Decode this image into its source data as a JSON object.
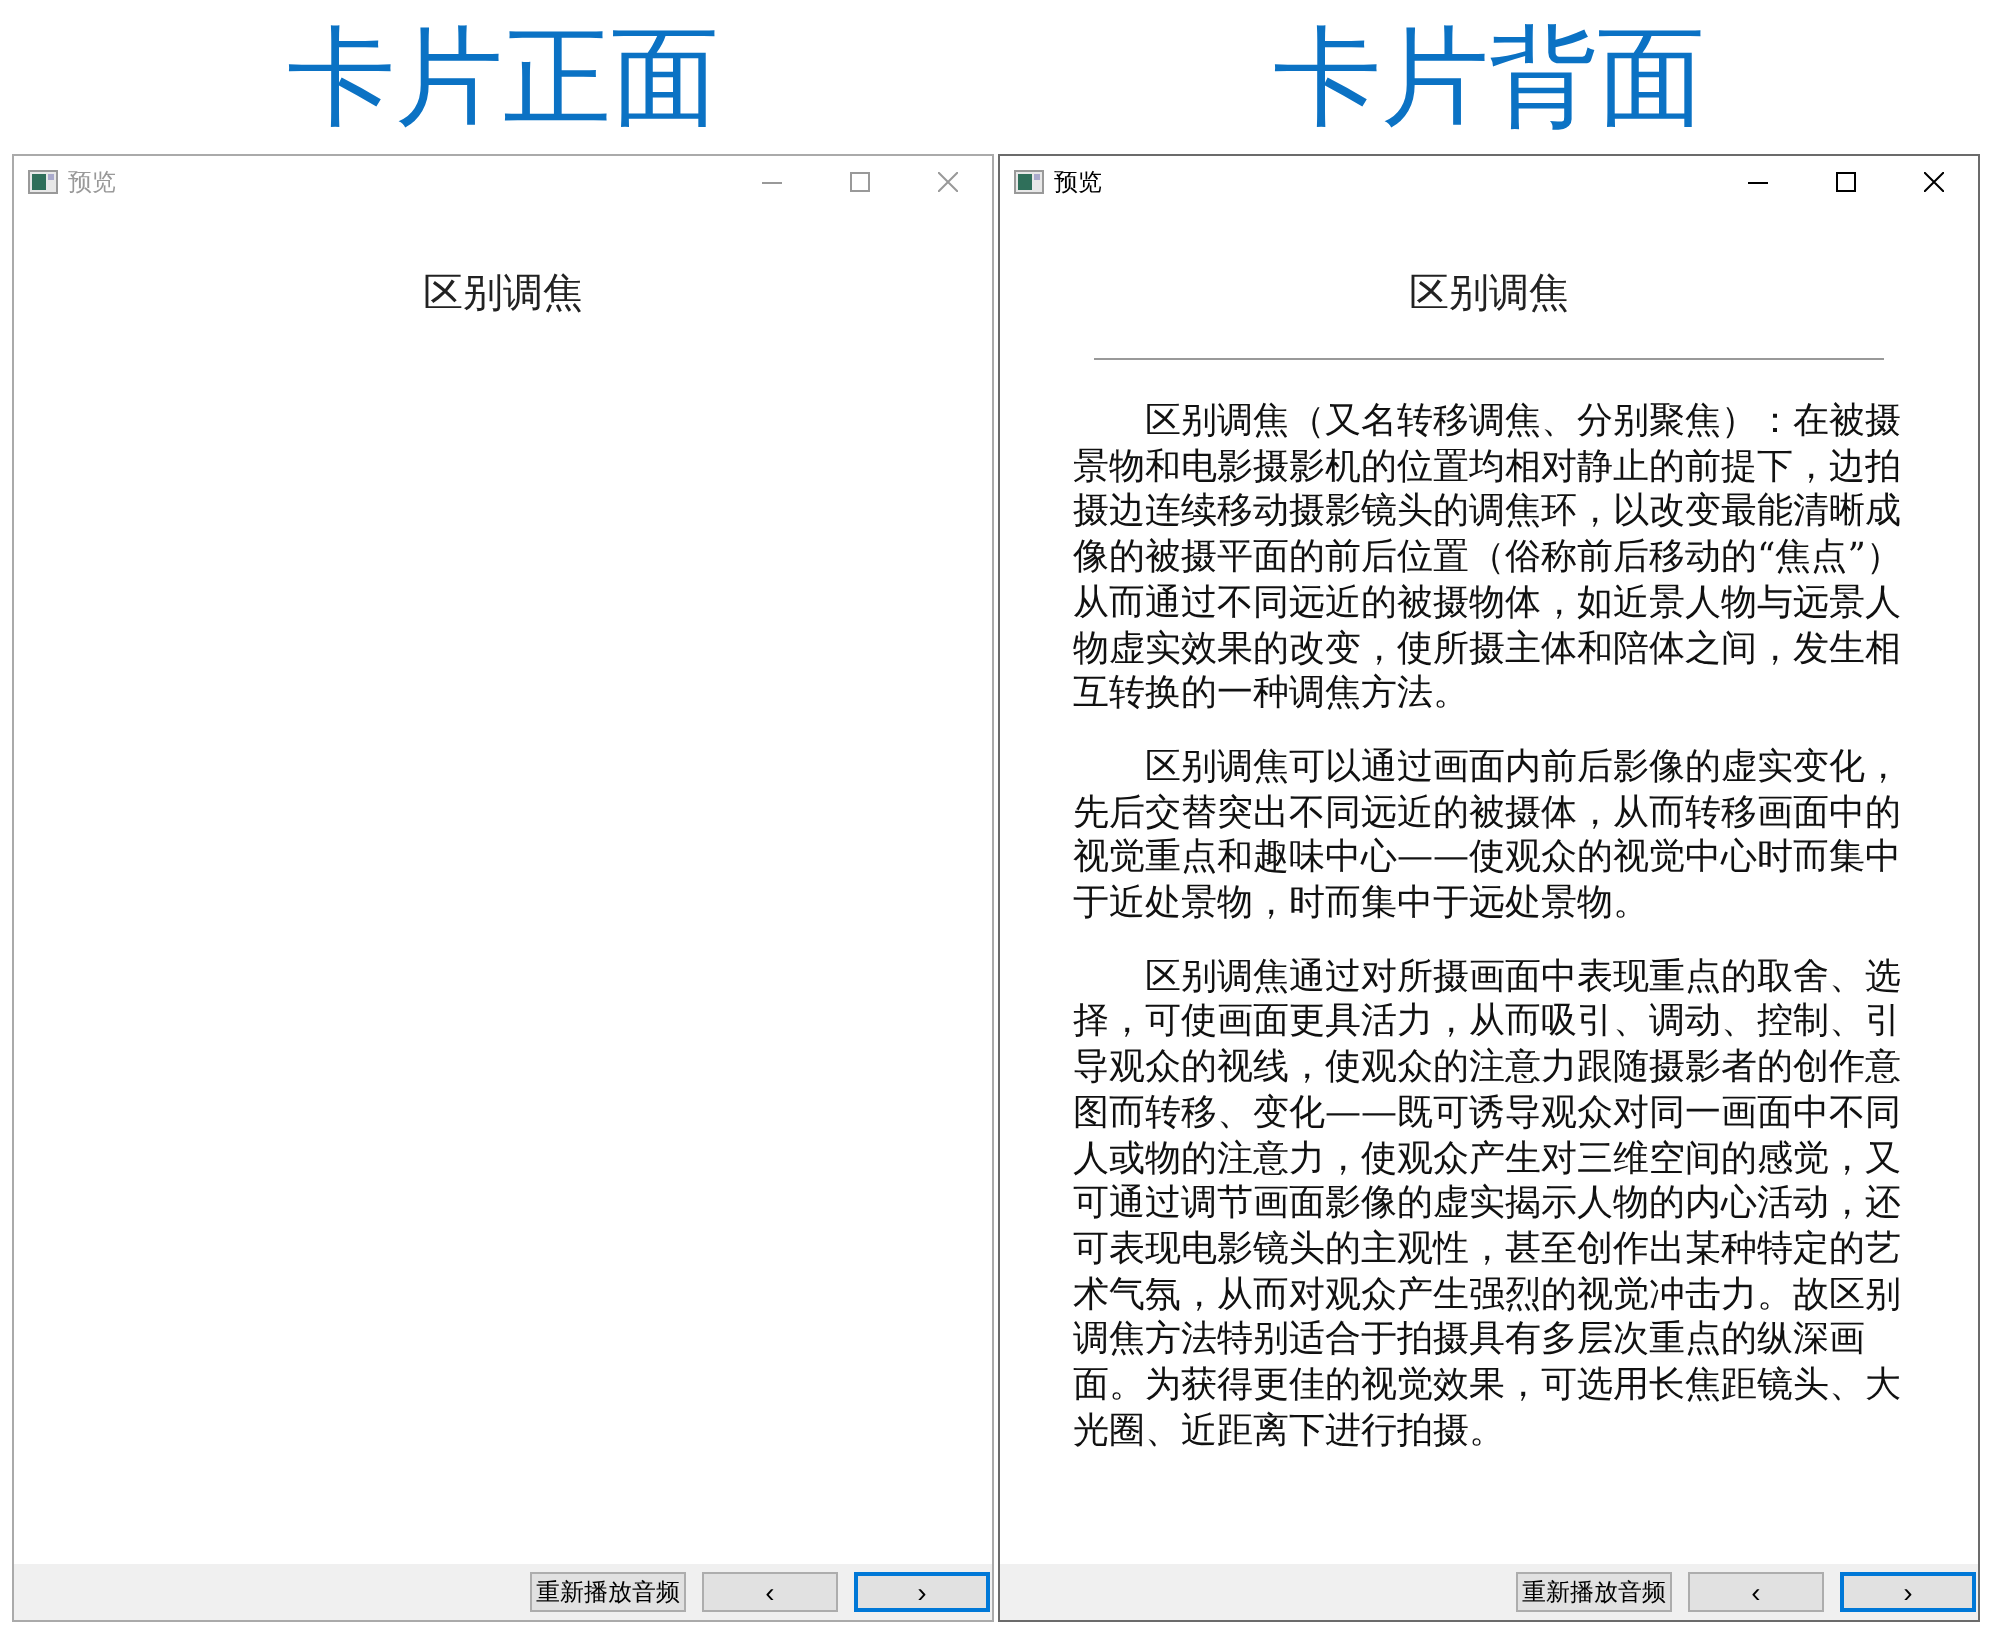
{
  "panels": [
    {
      "caption": "卡片正面",
      "window": {
        "title": "预览",
        "active": false
      },
      "card": {
        "title": "区别调焦"
      },
      "buttons": [
        {
          "label": "重新播放音频",
          "focused": false
        },
        {
          "label": "‹",
          "focused": false
        },
        {
          "label": "›",
          "focused": true
        }
      ]
    },
    {
      "caption": "卡片背面",
      "window": {
        "title": "预览",
        "active": true
      },
      "card": {
        "title": "区别调焦",
        "paragraphs": [
          "区别调焦（又名转移调焦、分别聚焦）：在被摄景物和电影摄影机的位置均相对静止的前提下，边拍摄边连续移动摄影镜头的调焦环，以改变最能清晰成像的被摄平面的前后位置（俗称前后移动的“焦点”）从而通过不同远近的被摄物体，如近景人物与远景人物虚实效果的改变，使所摄主体和陪体之间，发生相互转换的一种调焦方法。",
          "区别调焦可以通过画面内前后影像的虚实变化，先后交替突出不同远近的被摄体，从而转移画面中的视觉重点和趣味中心——使观众的视觉中心时而集中于近处景物，时而集中于远处景物。",
          "区别调焦通过对所摄画面中表现重点的取舍、选择，可使画面更具活力，从而吸引、调动、控制、引导观众的视线，使观众的注意力跟随摄影者的创作意图而转移、变化——既可诱导观众对同一画面中不同人或物的注意力，使观众产生对三维空间的感觉，又可通过调节画面影像的虚实揭示人物的内心活动，还可表现电影镜头的主观性，甚至创作出某种特定的艺术气氛，从而对观众产生强烈的视觉冲击力。故区别调焦方法特别适合于拍摄具有多层次重点的纵深画面。为获得更佳的视觉效果，可选用长焦距镜头、大光圈、近距离下进行拍摄。"
        ]
      },
      "buttons": [
        {
          "label": "重新播放音频",
          "focused": false
        },
        {
          "label": "‹",
          "focused": false
        },
        {
          "label": "›",
          "focused": true
        }
      ]
    }
  ]
}
